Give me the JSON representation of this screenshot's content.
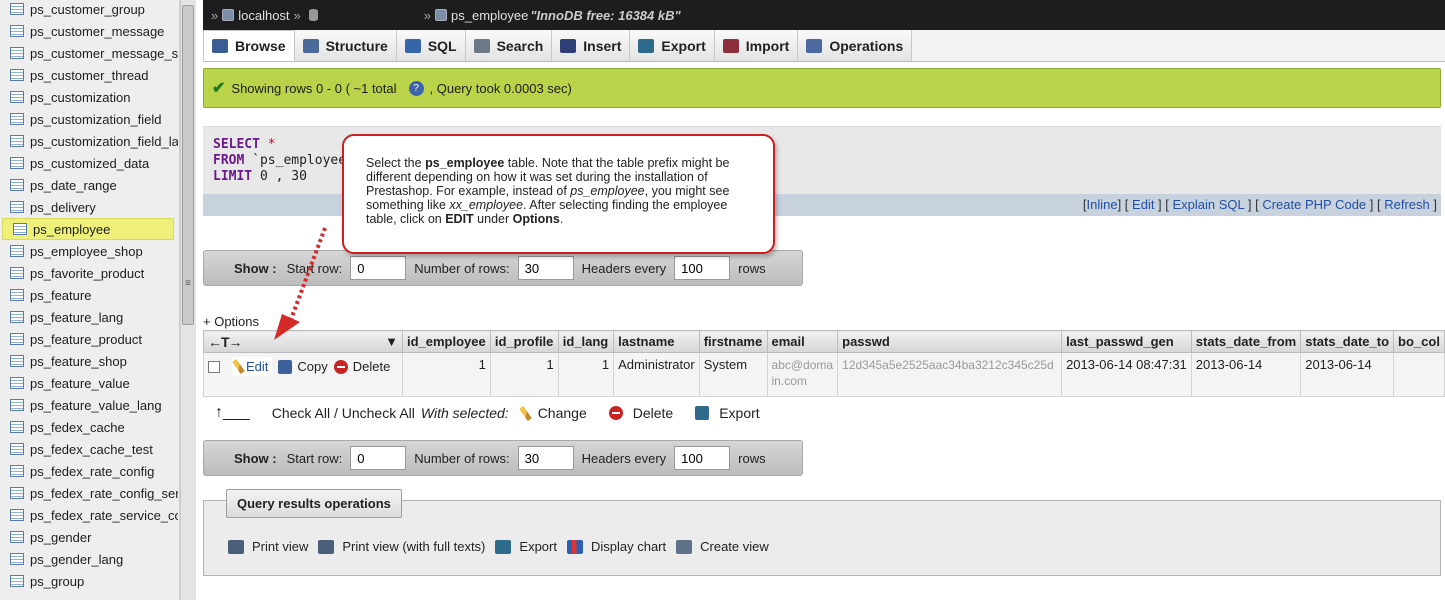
{
  "sidebar": {
    "items": [
      {
        "label": "ps_customer_group"
      },
      {
        "label": "ps_customer_message"
      },
      {
        "label": "ps_customer_message_s"
      },
      {
        "label": "ps_customer_thread"
      },
      {
        "label": "ps_customization"
      },
      {
        "label": "ps_customization_field"
      },
      {
        "label": "ps_customization_field_la"
      },
      {
        "label": "ps_customized_data"
      },
      {
        "label": "ps_date_range"
      },
      {
        "label": "ps_delivery"
      },
      {
        "label": "ps_employee",
        "active": true
      },
      {
        "label": "ps_employee_shop"
      },
      {
        "label": "ps_favorite_product"
      },
      {
        "label": "ps_feature"
      },
      {
        "label": "ps_feature_lang"
      },
      {
        "label": "ps_feature_product"
      },
      {
        "label": "ps_feature_shop"
      },
      {
        "label": "ps_feature_value"
      },
      {
        "label": "ps_feature_value_lang"
      },
      {
        "label": "ps_fedex_cache"
      },
      {
        "label": "ps_fedex_cache_test"
      },
      {
        "label": "ps_fedex_rate_config"
      },
      {
        "label": "ps_fedex_rate_config_ser"
      },
      {
        "label": "ps_fedex_rate_service_co"
      },
      {
        "label": "ps_gender"
      },
      {
        "label": "ps_gender_lang"
      },
      {
        "label": "ps_group"
      }
    ]
  },
  "topbar": {
    "server": "localhost",
    "sep1": "»",
    "sep2": "»",
    "table": "ps_employee",
    "table_info": "\"InnoDB free: 16384 kB\""
  },
  "tabs": [
    {
      "label": "Browse",
      "icon": "browse-icon",
      "color": "#3a5d93",
      "active": true
    },
    {
      "label": "Structure",
      "icon": "structure-icon",
      "color": "#4a6a9a"
    },
    {
      "label": "SQL",
      "icon": "sql-icon",
      "color": "#3567a8"
    },
    {
      "label": "Search",
      "icon": "search-icon",
      "color": "#6c7a88"
    },
    {
      "label": "Insert",
      "icon": "insert-icon",
      "color": "#2d3f76"
    },
    {
      "label": "Export",
      "icon": "export-icon",
      "color": "#2e6a8c"
    },
    {
      "label": "Import",
      "icon": "import-icon",
      "color": "#8c2e3b"
    },
    {
      "label": "Operations",
      "icon": "wrench-icon",
      "color": "#4d6aa0"
    }
  ],
  "success": {
    "text_before": "Showing rows 0 - 0 ( ~1 total",
    "text_after": ", Query took 0.0003 sec)"
  },
  "sql": {
    "line1_kw": "SELECT",
    "line1_rest": " *",
    "line2_kw": "FROM",
    "line2_rest": " `ps_employee",
    "line3_kw": "LIMIT",
    "line3_rest": " 0 , 30",
    "links": {
      "inline": "Inline",
      "edit": "Edit",
      "explain": "Explain SQL",
      "php": "Create PHP Code",
      "refresh": "Refresh"
    }
  },
  "showbar": {
    "show": "Show :",
    "start_row_label": "Start row:",
    "start_row_value": "0",
    "rows_label": "Number of rows:",
    "rows_value": "30",
    "headers_label": "Headers every",
    "headers_value": "100",
    "rows_suffix": "rows"
  },
  "options_link": "+ Options",
  "table": {
    "columns": [
      "id_employee",
      "id_profile",
      "id_lang",
      "lastname",
      "firstname",
      "email",
      "passwd",
      "last_passwd_gen",
      "stats_date_from",
      "stats_date_to",
      "bo_col"
    ],
    "row": {
      "edit": "Edit",
      "copy": "Copy",
      "delete": "Delete",
      "id_employee": "1",
      "id_profile": "1",
      "id_lang": "1",
      "lastname": "Administrator",
      "firstname": "System",
      "email": "abc@domain.com",
      "passwd": "12d345a5e2525aac34ba3212c345c25d",
      "last_passwd_gen": "2013-06-14 08:47:31",
      "stats_date_from": "2013-06-14",
      "stats_date_to": "2013-06-14"
    }
  },
  "checkall": {
    "label": "Check All / Uncheck All",
    "with_selected": "With selected:",
    "change": "Change",
    "delete": "Delete",
    "export": "Export"
  },
  "query_ops": {
    "title": "Query results operations",
    "print": "Print view",
    "print_full": "Print view (with full texts)",
    "export": "Export",
    "chart": "Display chart",
    "create_view": "Create view"
  },
  "callout": {
    "p1": "Select the ",
    "b1": "ps_employee",
    "p2": " table.  Note that the table prefix might be different depending on how it was set during the installation of Prestashop. For example, instead of ",
    "i1": "ps_employee",
    "p3": ", you might see something like ",
    "i2": "xx_employee",
    "p4": ". After selecting finding the employee table, click on ",
    "b2": "EDIT",
    "p5": " under ",
    "b3": "Options",
    "p6": "."
  },
  "colors": {
    "callout_border": "#cc1f1f",
    "success_bg": "#b9d448",
    "highlight": "#eef07a"
  }
}
